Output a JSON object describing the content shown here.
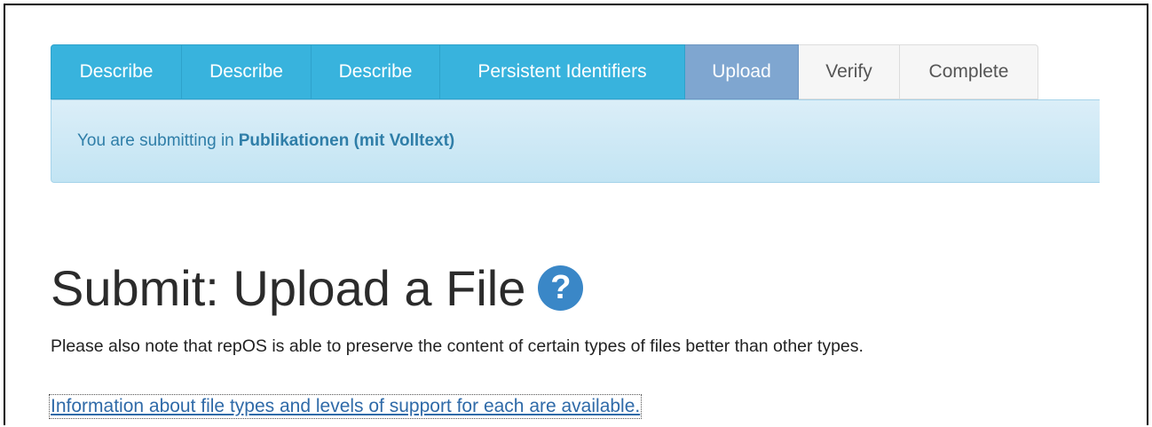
{
  "tabs": [
    {
      "label": "Describe",
      "state": "completed"
    },
    {
      "label": "Describe",
      "state": "completed"
    },
    {
      "label": "Describe",
      "state": "completed"
    },
    {
      "label": "Persistent Identifiers",
      "state": "completed"
    },
    {
      "label": "Upload",
      "state": "active"
    },
    {
      "label": "Verify",
      "state": "todo"
    },
    {
      "label": "Complete",
      "state": "todo"
    }
  ],
  "alert": {
    "prefix": "You are submitting in",
    "collection": "Publikationen (mit Volltext)"
  },
  "heading": {
    "title": "Submit: Upload a File",
    "help_icon": "question-circle-icon"
  },
  "note": "Please also note that repOS is able to preserve the content of certain types of files better than other types.",
  "link": "Information about file types and levels of support for each are available.",
  "colors": {
    "tab_completed": "#38b3dd",
    "tab_active": "#7fa6d0",
    "tab_todo": "#f6f6f6",
    "alert_bg": "#c2e4f3",
    "alert_text": "#2f7ea8",
    "link": "#2f6aa8",
    "help_icon": "#3a87c7"
  }
}
